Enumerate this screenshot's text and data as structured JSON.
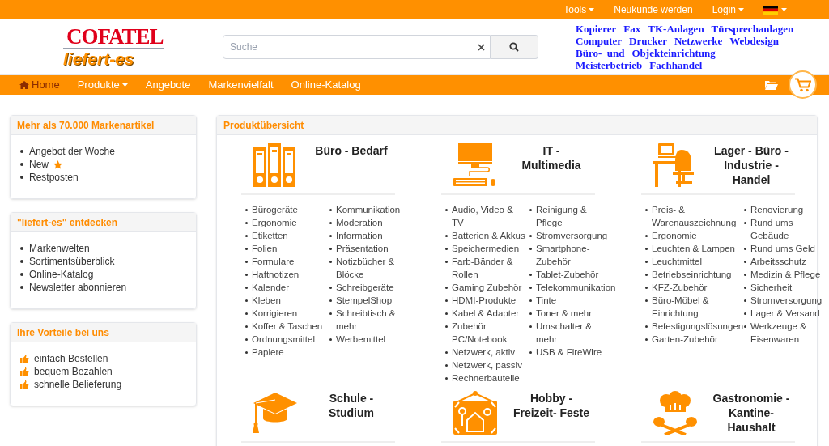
{
  "top_bar": {
    "items": [
      {
        "label": "Tools",
        "kind": "dropdown"
      },
      {
        "label": "Neukunde werden",
        "kind": "link"
      },
      {
        "label": "Login",
        "kind": "dropdown"
      },
      {
        "kind": "flag"
      }
    ]
  },
  "header": {
    "logo": {
      "brand": "COFATEL",
      "tagline": "liefert-es"
    },
    "search": {
      "placeholder": "Suche"
    },
    "services": [
      [
        "Kopierer",
        "Fax",
        "TK-Anlagen",
        "Türsprechanlagen"
      ],
      [
        "Computer",
        "Drucker",
        "Netzwerke",
        "Webdesign"
      ],
      [
        "Büro-  und",
        "Objekteinrichtung"
      ],
      [
        "Meisterbetrieb",
        "Fachhandel"
      ]
    ]
  },
  "nav": {
    "items": [
      {
        "label": "Home",
        "kind": "home",
        "selected": true
      },
      {
        "label": "Produkte",
        "kind": "dropdown",
        "selected": false
      },
      {
        "label": "Angebote",
        "kind": "link",
        "selected": false
      },
      {
        "label": "Markenvielfalt",
        "kind": "link",
        "selected": false
      },
      {
        "label": "Online-Katalog",
        "kind": "link",
        "selected": false
      }
    ]
  },
  "sidebar": {
    "panels": [
      {
        "title": "Mehr als 70.000 Markenartikel",
        "items": [
          {
            "label": "Angebot der Woche",
            "kind": "bullet",
            "starred": false
          },
          {
            "label": "New",
            "kind": "bullet",
            "starred": true
          },
          {
            "label": "Restposten",
            "kind": "bullet",
            "starred": false
          }
        ]
      },
      {
        "title": "\"liefert-es\" entdecken",
        "items": [
          {
            "label": "Markenwelten",
            "kind": "bullet",
            "starred": false
          },
          {
            "label": "Sortimentsüberblick",
            "kind": "bullet",
            "starred": false
          },
          {
            "label": "Online-Katalog",
            "kind": "bullet",
            "starred": false
          },
          {
            "label": "Newsletter abonnieren",
            "kind": "bullet",
            "starred": false
          }
        ]
      },
      {
        "title": "Ihre Vorteile bei uns",
        "items": [
          {
            "label": "einfach Bestellen",
            "kind": "thumb",
            "starred": false
          },
          {
            "label": "bequem Bezahlen",
            "kind": "thumb",
            "starred": false
          },
          {
            "label": "schnelle Belieferung",
            "kind": "thumb",
            "starred": false
          }
        ]
      }
    ]
  },
  "main": {
    "title": "Produktübersicht",
    "categories": [
      {
        "title_lines": [
          "Büro - Bedarf"
        ],
        "left": [
          "Bürogeräte",
          "Ergonomie",
          "Etiketten",
          "Folien",
          "Formulare",
          "Haftnotizen",
          "Kalender",
          "Kleben",
          "Korrigieren",
          "Koffer & Taschen",
          "Ordnungsmittel",
          "Papiere"
        ],
        "right": [
          "Kommunikation",
          "Moderation",
          "Information",
          "Präsentation",
          "Notizbücher & Blöcke",
          "Schreibgeräte",
          "StempelShop",
          "Schreibtisch & mehr",
          "Werbemittel"
        ]
      },
      {
        "title_lines": [
          "IT -",
          "Multimedia"
        ],
        "left": [
          "Audio, Video & TV",
          "Batterien & Akkus",
          "Speichermedien",
          "Farb-Bänder & Rollen",
          "Gaming Zubehör",
          "HDMI-Produkte",
          "Kabel & Adapter",
          "Zubehör PC/Notebook",
          "Netzwerk, aktiv",
          "Netzwerk, passiv",
          "Rechnerbauteile"
        ],
        "right": [
          "Reinigung & Pflege",
          "Stromversorgung",
          "Smartphone-Zubehör",
          "Tablet-Zubehör",
          "Telekommunikation",
          "Tinte",
          "Toner & mehr",
          "Umschalter & mehr",
          "USB & FireWire"
        ]
      },
      {
        "title_lines": [
          "Lager - Büro -",
          "Industrie -",
          "Handel"
        ],
        "left": [
          "Preis- & Warenauszeichnung",
          "Ergonomie",
          "Leuchten & Lampen",
          "Leuchtmittel",
          "Betriebseinrichtung",
          "KFZ-Zubehör",
          "Büro-Möbel & Einrichtung",
          "Befestigungslösungen",
          "Garten-Zubehör"
        ],
        "right": [
          "Renovierung",
          "Rund ums Gebäude",
          "Rund ums Geld",
          "Arbeitsschutz",
          "Medizin & Pflege",
          "Sicherheit",
          "Stromversorgung",
          "Lager & Versand",
          "Werkzeuge & Eisenwaren"
        ]
      },
      {
        "title_lines": [
          "Schule -",
          "Studium"
        ]
      },
      {
        "title_lines": [
          "Hobby -",
          "Freizeit- Feste"
        ]
      },
      {
        "title_lines": [
          "Gastronomie -",
          "Kantine-",
          "Haushalt"
        ]
      }
    ]
  }
}
